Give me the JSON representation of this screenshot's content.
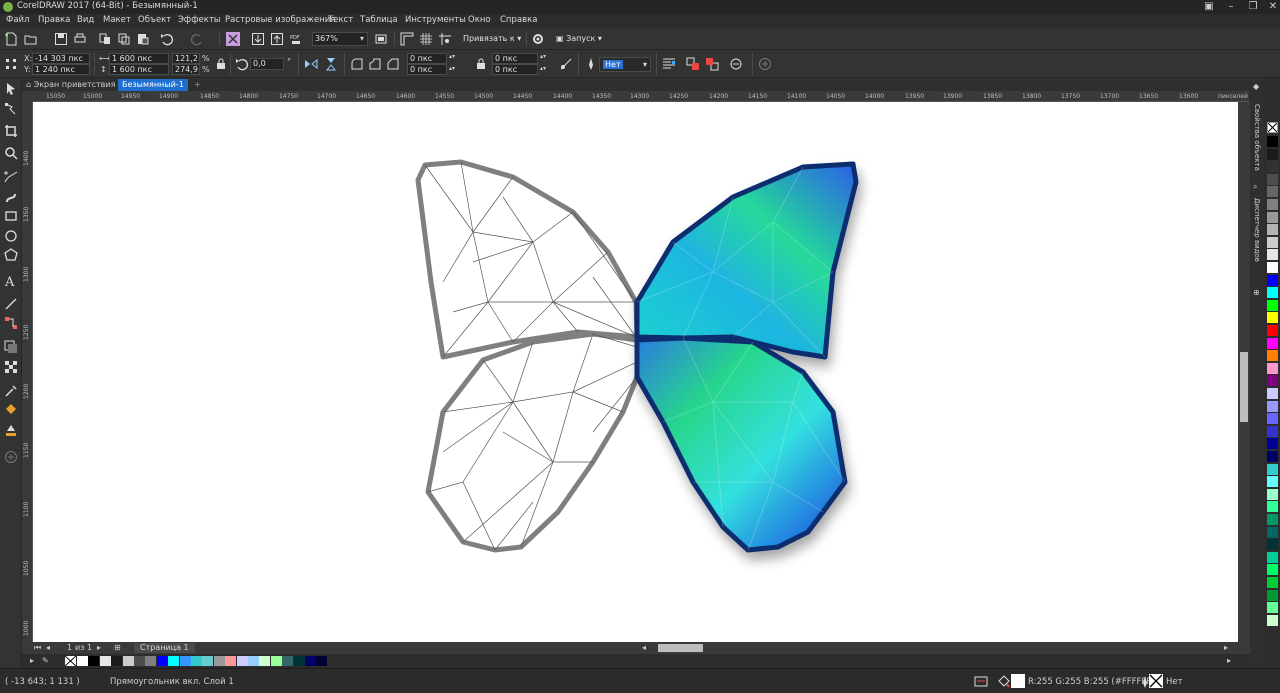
{
  "window": {
    "title": "CorelDRAW 2017 (64-Bit) - Безымянный-1",
    "controls": [
      "minimize",
      "maximize",
      "close"
    ]
  },
  "menu": [
    "Файл",
    "Правка",
    "Вид",
    "Макет",
    "Объект",
    "Эффекты",
    "Растровые изображения",
    "Текст",
    "Таблица",
    "Инструменты",
    "Окно",
    "Справка"
  ],
  "toolbar": {
    "zoom": "367%",
    "snap_label": "Привязать к",
    "launch_label": "Запуск"
  },
  "property_bar": {
    "x_label": "X:",
    "x_value": "-14 303 пкс",
    "y_label": "Y:",
    "y_value": "1 240 пкс",
    "width_value": "1 600 пкс",
    "height_value": "1 600 пкс",
    "scale_x": "121,2",
    "scale_y": "274,9",
    "percent": "%",
    "rotation": "0,0",
    "corner_1": "0 пкс",
    "corner_2": "0 пкс",
    "corner_3": "0 пкс",
    "corner_4": "0 пкс",
    "outline_width": "Нет"
  },
  "tabs": [
    {
      "label": "Экран приветствия",
      "active": false
    },
    {
      "label": "Безымянный-1",
      "active": true
    }
  ],
  "ruler": {
    "unit": "пикселей",
    "h_ticks": [
      "15050",
      "15000",
      "14950",
      "14900",
      "14850",
      "14800",
      "14750",
      "14700",
      "14650",
      "14600",
      "14550",
      "14500",
      "14450",
      "14400",
      "14350",
      "14300",
      "14250",
      "14200",
      "14150",
      "14100",
      "14050",
      "14000",
      "13950",
      "13900",
      "13850",
      "13800",
      "13750",
      "13700",
      "13650",
      "13600"
    ],
    "v_ticks": [
      "1400",
      "1350",
      "1300",
      "1250",
      "1200",
      "1150",
      "1100",
      "1050",
      "1000",
      "950"
    ]
  },
  "page_nav": {
    "current": "1",
    "of_label": "из",
    "total": "1",
    "page_tab": "Страница 1"
  },
  "dockers": {
    "object_properties": "Свойства объекта",
    "view_manager": "Диспетчер видов"
  },
  "palette_colors": [
    "#000000",
    "#1a1a1a",
    "#333333",
    "#4d4d4d",
    "#666666",
    "#808080",
    "#999999",
    "#b3b3b3",
    "#cccccc",
    "#e6e6e6",
    "#ffffff",
    "#0000ff",
    "#00ffff",
    "#00ff00",
    "#ffff00",
    "#ff0000",
    "#ff00ff",
    "#ff8000",
    "#ff99cc",
    "#800080",
    "#ccccff",
    "#9999ff",
    "#6666ff",
    "#3333cc",
    "#000099",
    "#000066",
    "#33cccc",
    "#66ffff",
    "#99ffcc",
    "#33ff99",
    "#009966",
    "#006666",
    "#003333",
    "#00cc99",
    "#00ff66",
    "#00cc33",
    "#009933",
    "#66ff99",
    "#ccffcc"
  ],
  "document_palette": [
    "#ffffff",
    "#000000",
    "#e6e6e6",
    "#1a1a1a",
    "#cccccc",
    "#4d4d4d",
    "#808080",
    "#0000ff",
    "#00ffff",
    "#3399ff",
    "#33cccc",
    "#66cccc",
    "#999999",
    "#ff9999",
    "#ccccff",
    "#99ccff",
    "#ccffcc",
    "#99ff99",
    "#336666",
    "#003333",
    "#000066",
    "#000033"
  ],
  "status": {
    "coordinates": "( -13 643; 1 131 )",
    "object_info": "Прямоугольник вкл. Слой 1",
    "fill_info": "R:255 G:255 B:255 (#FFFFFF)",
    "outline_info": "Нет"
  }
}
